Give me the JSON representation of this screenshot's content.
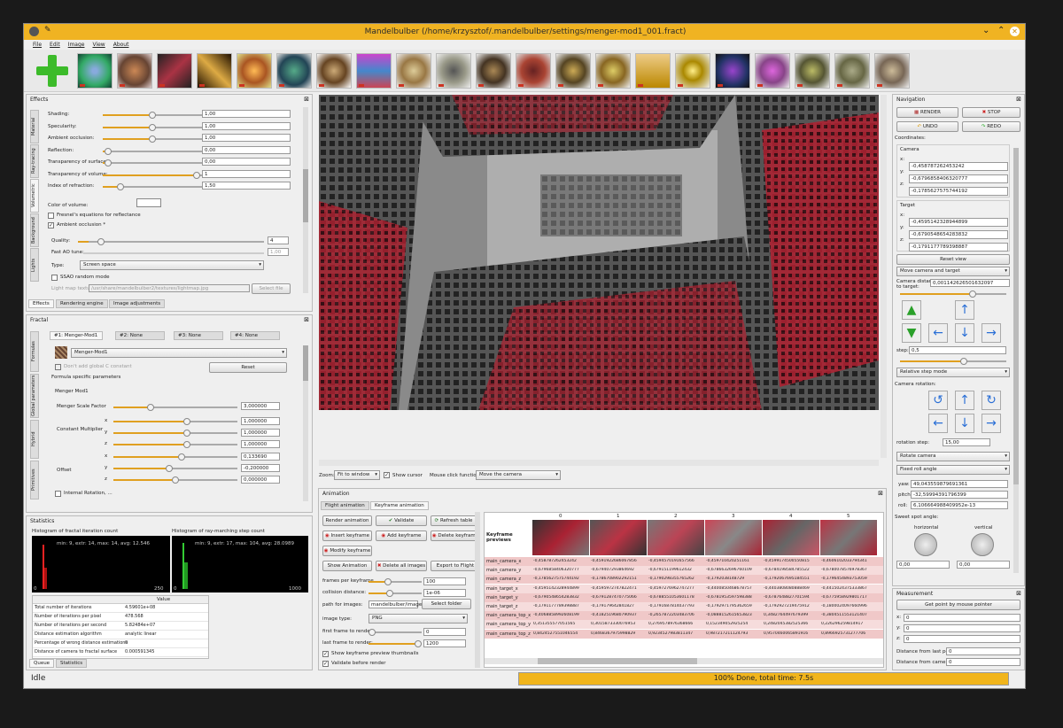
{
  "window": {
    "title": "Mandelbulber (/home/krzysztof/.mandelbulber/settings/menger-mod1_001.fract)"
  },
  "menu": [
    "File",
    "Edit",
    "Image",
    "View",
    "About"
  ],
  "effects": {
    "title": "Effects",
    "tabs_vertical": [
      "Material",
      "Ray-tracing",
      "Volumetric",
      "Background",
      "Lights"
    ],
    "rows": [
      {
        "label": "Shading:",
        "value": "1,00",
        "pos": 0.5
      },
      {
        "label": "Specularity:",
        "value": "1,00",
        "pos": 0.5
      },
      {
        "label": "Ambient occlusion:",
        "value": "1,00",
        "pos": 0.5
      },
      {
        "label": "Reflection:",
        "value": "0,00",
        "pos": 0.02
      },
      {
        "label": "Transparency of surface:",
        "value": "0,00",
        "pos": 0.02
      },
      {
        "label": "Transparency of volume:",
        "value": "1",
        "pos": 0.98
      },
      {
        "label": "Index of refraction:",
        "value": "1,50",
        "pos": 0.15
      }
    ],
    "color_of_volume": "Color of volume:",
    "fresnel": "Fresnel's equations for reflectance",
    "ambient_occlusion": "Ambient occlusion *",
    "quality_label": "Quality:",
    "quality": "4",
    "fast_ao_label": "Fast AO tune:",
    "fast_ao": "1,00",
    "type_label": "Type:",
    "type_value": "Screen space",
    "ssao_random": "SSAO random mode",
    "light_map_label": "Light map texture:",
    "light_map_path": "/usr/share/mandelbulber2/textures/lightmap.jpg",
    "select_file": "Select file",
    "bottom_tabs": [
      "Effects",
      "Rendering engine",
      "Image adjustments"
    ]
  },
  "fractal": {
    "title": "Fractal",
    "tabs": [
      "#1: Menger-Mod1",
      "#2: None",
      "#3: None",
      "#4: None"
    ],
    "vtabs": [
      "Formulas",
      "Global parameters",
      "Hybrid",
      "Primitives"
    ],
    "formula": "Menger-Mod1",
    "dont_add_c": "Don't add global C constant",
    "reset": "Reset",
    "specific": "Formula specific parameters",
    "group": "Menger Mod1",
    "scale_label": "Menger Scale Factor",
    "scale_value": "3,000000",
    "constant_label": "Constant Multiplier",
    "const": [
      {
        "axis": "x",
        "value": "1,000000"
      },
      {
        "axis": "y",
        "value": "1,000000"
      },
      {
        "axis": "z",
        "value": "1,000000"
      }
    ],
    "offset_label": "Offset",
    "offset": [
      {
        "axis": "x",
        "value": "0,133690"
      },
      {
        "axis": "y",
        "value": "-0,200000"
      },
      {
        "axis": "z",
        "value": "0,000000"
      }
    ],
    "internal_rotation": "Internal Rotation, ..."
  },
  "statistics": {
    "title": "Statistics",
    "hist1_title": "Histogram of fractal iteration count",
    "hist1_info": "min: 9, extr: 14, max: 14, avg: 12.546",
    "hist1_axis_left": "0",
    "hist1_axis_right": "250",
    "hist2_title": "Histogram of ray-marching step count",
    "hist2_info": "min: 9, extr: 17, max: 104, avg: 28.0989",
    "hist2_axis_left": "0",
    "hist2_axis_right": "1000",
    "table_header": "Value",
    "rows": [
      [
        "Total number of iterations",
        "4.59601e+08"
      ],
      [
        "Number of iterations per pixel",
        "478.568"
      ],
      [
        "Number of iterations per second",
        "5.82484e+07"
      ],
      [
        "Distance estimation algorithm",
        "analytic linear"
      ],
      [
        "Percentage of wrong distance estimations",
        "0"
      ],
      [
        "Distance of camera to fractal surface",
        "0.000591345"
      ]
    ],
    "tabs": [
      "Queue",
      "Statistics"
    ]
  },
  "viewport": {
    "zoom_label": "Zoom:",
    "zoom_value": "Fit to window",
    "show_cursor": "Show cursor",
    "mouse_click_label": "Mouse click function:",
    "mouse_click_value": "Move the camera"
  },
  "animation": {
    "title": "Animation",
    "tabs": [
      "Flight animation",
      "Keyframe animation"
    ],
    "buttons": [
      "Render animation",
      "Validate",
      "Refresh table",
      "Insert keyframe",
      "Add keyframe",
      "Delete keyframe",
      "Modify keyframe",
      "Show Animation",
      "Delete all images",
      "Export to Flight"
    ],
    "frames_label": "frames per keyframe",
    "frames_value": "100",
    "collision_label": "collision distance:",
    "collision_value": "1e-06",
    "path_label": "path for images:",
    "path_value": "mandelbulber/images/",
    "select_folder": "Select folder",
    "image_type_label": "image type:",
    "image_type_value": "PNG",
    "first_frame_label": "first frame to render:",
    "first_frame_value": "0",
    "last_frame_label": "last frame to render:",
    "last_frame_value": "1200",
    "show_thumbs": "Show keyframe preview thumbnails",
    "validate_before": "Validate before render",
    "kf_header": "Keyframe previews",
    "columns": [
      "0",
      "1",
      "2",
      "3",
      "4",
      "5"
    ],
    "rows": [
      {
        "name": "main_camera_x",
        "vals": [
          "-0,458787262453242",
          "-0,4591922686067856",
          "-0,45945701916575​66",
          "-0,459710420251161",
          "-0,4599174500550815",
          "-0,4606102033794341"
        ]
      },
      {
        "name": "main_camera_y",
        "vals": [
          "-0,6796858406320777",
          "-0,679407293864692",
          "-0,679151199612432",
          "-0,6786632696760109",
          "-0,6784198584785522",
          "-0,6780078576978367"
        ]
      },
      {
        "name": "main_camera_z",
        "vals": [
          "-0,1785627575744192",
          "-0,1786708902292151",
          "-0,1790298355765262",
          "-0,1792038148729",
          "-0,1792067695184551",
          "-0,1796454893753059"
        ]
      },
      {
        "name": "main_target_x",
        "vals": [
          "-0,4595142328944899",
          "-0,4595972747822471",
          "-0,4597276962747277",
          "-0,4400850468678757",
          "-0,4403808080888469",
          "-0,4415024375333867"
        ]
      },
      {
        "name": "main_target_y",
        "vals": [
          "-0,679054865428383​2",
          "-0,6791287470775066",
          "-0,6788551053601178",
          "-0,6781953597598388",
          "-0,6787648827701594",
          "-0,6775958929801717"
        ]
      },
      {
        "name": "main_target_z",
        "vals": [
          "-0,1791177789398887",
          "-0,179179642841827",
          "-0,1791687814037793",
          "-0,1792971795362659",
          "-0,1792927219475912",
          "-0,1800024097660996"
        ]
      },
      {
        "name": "main_camera_top_x",
        "vals": [
          "-0,4068858992608199",
          "-0,4182519680790937",
          "-0,2657872203483706",
          "-0,0888152615653823",
          "0,3482764497679399",
          "-0,3804511553121407"
        ]
      },
      {
        "name": "main_camera_top_y",
        "vals": [
          "0,351355577051565",
          "0,3015873330076953",
          "0,2769578976368666",
          "0,152349052925254",
          "0,2482045382525366",
          "0,226296259814917"
        ]
      },
      {
        "name": "main_camera_top_z",
        "vals": [
          "0,8424527551046554",
          "0,8468367975998829",
          "0,9234527983811347",
          "0,987217211124793",
          "0,9570460065891916",
          "0,8966925731277706"
        ]
      }
    ]
  },
  "navigation": {
    "title": "Navigation",
    "render": "RENDER",
    "stop": "STOP",
    "undo": "UNDO",
    "redo": "REDO",
    "coordinates": "Coordinates:",
    "camera_label": "Camera",
    "camera": [
      {
        "axis": "x:",
        "value": "-0,458787262453242"
      },
      {
        "axis": "y:",
        "value": "-0,6796858406320777"
      },
      {
        "axis": "z:",
        "value": "-0,1785627575744192"
      }
    ],
    "target_label": "Target",
    "target": [
      {
        "axis": "x:",
        "value": "-0,4595142328944899"
      },
      {
        "axis": "y:",
        "value": "-0,6790548654283832"
      },
      {
        "axis": "z:",
        "value": "-0,1791177789398887"
      }
    ],
    "reset_view": "Reset view",
    "mode": "Move camera and target",
    "cam_dist_label": "Camera distance to target:",
    "cam_dist_value": "0,001142626501632097",
    "step_label": "step:",
    "step_value": "0,5",
    "step_mode": "Relative step mode",
    "rotation_label": "Camera rotation:",
    "rotation_step_label": "rotation step:",
    "rotation_step_value": "15,00",
    "rotate_mode": "Rotate camera",
    "roll_mode": "Fixed roll angle",
    "yaw_label": "yaw:",
    "yaw": "49,04355987969136​1",
    "pitch_label": "pitch:",
    "pitch": "-32,59994391796399",
    "roll_label": "roll:",
    "roll": "6,10666498840995​2e-13",
    "sweet_spot": "Sweet spot angle:",
    "horizontal": "horizontal",
    "vertical": "vertical",
    "h_value": "0,00",
    "v_value": "0,00"
  },
  "measurement": {
    "title": "Measurement",
    "get_point": "Get point by mouse pointer",
    "fields": [
      {
        "label": "x:",
        "value": "0"
      },
      {
        "label": "y:",
        "value": "0"
      },
      {
        "label": "z:",
        "value": "0"
      }
    ],
    "from_last_label": "Distance from last point:",
    "from_last": "0",
    "from_camera_label": "Distance from camera:",
    "from_camera": "0"
  },
  "status": {
    "left": "Idle",
    "progress_text": "100% Done, total time: 7.5s",
    "progress": 1.0
  }
}
